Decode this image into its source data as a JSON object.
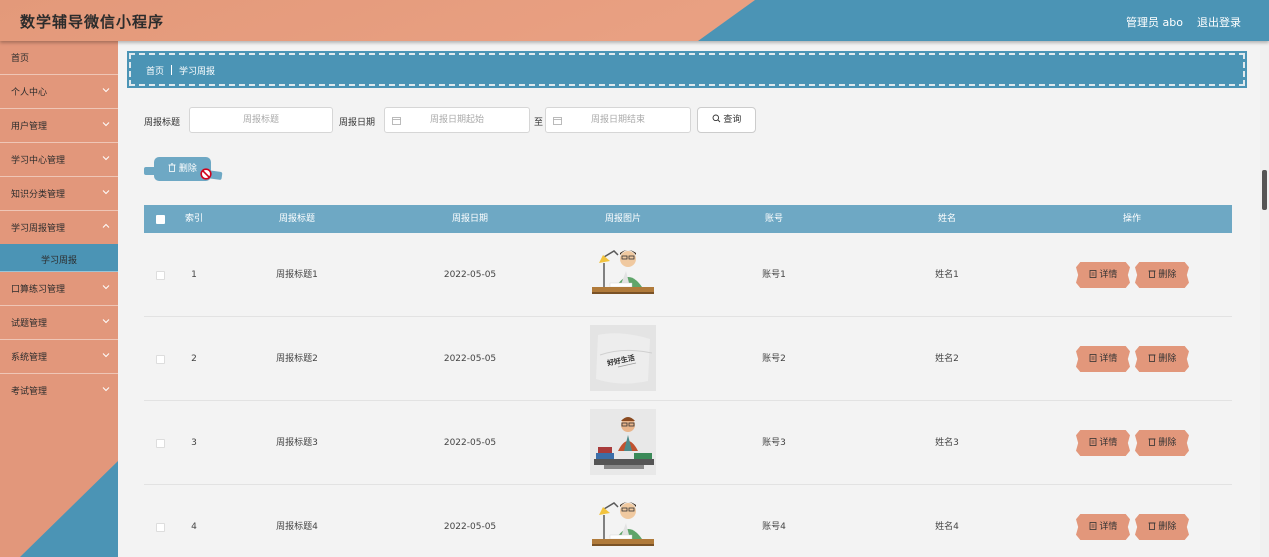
{
  "app": {
    "title": "数学辅导微信小程序",
    "user": "管理员 abo",
    "logout": "退出登录"
  },
  "sidebar": {
    "items": [
      {
        "label": "首页",
        "chevron": false
      },
      {
        "label": "个人中心",
        "chevron": true
      },
      {
        "label": "用户管理",
        "chevron": true
      },
      {
        "label": "学习中心管理",
        "chevron": true
      },
      {
        "label": "知识分类管理",
        "chevron": true
      },
      {
        "label": "学习周报管理",
        "chevron": true
      },
      {
        "label": "学习周报",
        "sub": true,
        "active": true
      },
      {
        "label": "口算练习管理",
        "chevron": true
      },
      {
        "label": "试题管理",
        "chevron": true
      },
      {
        "label": "系统管理",
        "chevron": true
      },
      {
        "label": "考试管理",
        "chevron": true
      }
    ]
  },
  "breadcrumb": {
    "home": "首页",
    "current": "学习周报"
  },
  "search": {
    "title_label": "周报标题",
    "title_placeholder": "周报标题",
    "date_label": "周报日期",
    "date_start_placeholder": "周报日期起始",
    "date_to": "至",
    "date_end_placeholder": "周报日期结束",
    "query_button": "查询"
  },
  "toolbar": {
    "delete_label": "删除"
  },
  "table": {
    "headers": {
      "index": "索引",
      "title": "周报标题",
      "date": "周报日期",
      "image": "周报图片",
      "account": "账号",
      "name": "姓名",
      "actions": "操作"
    },
    "rows": [
      {
        "index": "1",
        "title": "周报标题1",
        "date": "2022-05-05",
        "image": "student-desk",
        "account": "账号1",
        "name": "姓名1"
      },
      {
        "index": "2",
        "title": "周报标题2",
        "date": "2022-05-05",
        "image": "paper-note",
        "account": "账号2",
        "name": "姓名2"
      },
      {
        "index": "3",
        "title": "周报标题3",
        "date": "2022-05-05",
        "image": "man-books",
        "account": "账号3",
        "name": "姓名3"
      },
      {
        "index": "4",
        "title": "周报标题4",
        "date": "2022-05-05",
        "image": "student-desk",
        "account": "账号4",
        "name": "姓名4"
      }
    ],
    "detail_label": "详情",
    "delete_label": "删除"
  },
  "image_texts": {
    "paper_note": "好好生活"
  },
  "colors": {
    "accent_blue": "#4b94b5",
    "accent_salmon": "#e2977b",
    "table_header": "#6ea8c4"
  }
}
